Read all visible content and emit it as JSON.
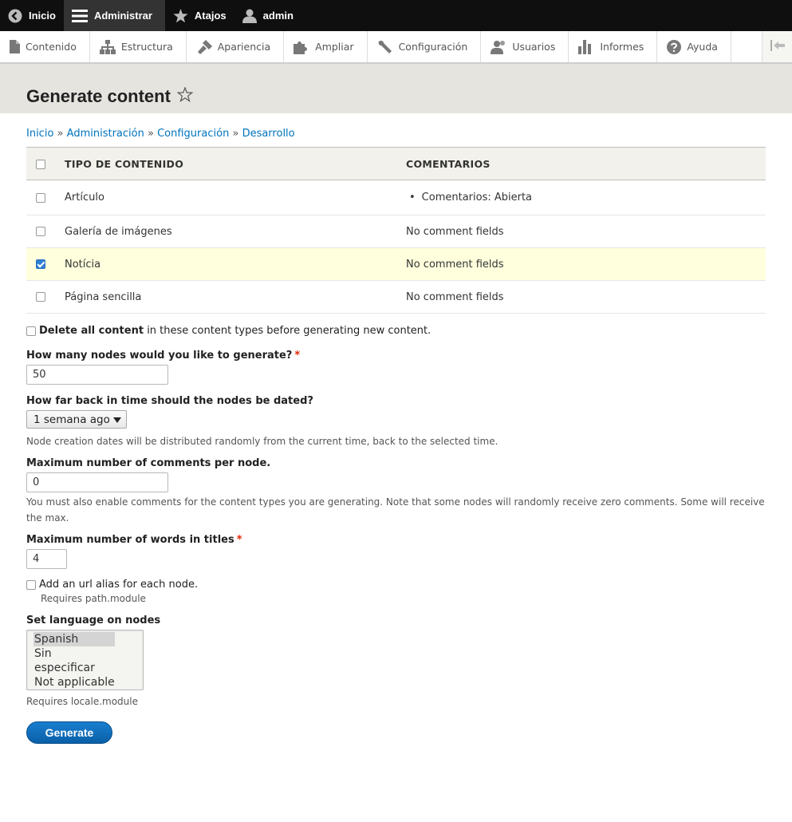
{
  "toolbar": {
    "home": "Inicio",
    "manage": "Administrar",
    "shortcuts": "Atajos",
    "user": "admin"
  },
  "tray": {
    "items": [
      {
        "label": "Contenido",
        "icon": "page-icon"
      },
      {
        "label": "Estructura",
        "icon": "sitemap-icon"
      },
      {
        "label": "Apariencia",
        "icon": "brush-icon"
      },
      {
        "label": "Ampliar",
        "icon": "puzzle-icon"
      },
      {
        "label": "Configuración",
        "icon": "wrench-icon"
      },
      {
        "label": "Usuarios",
        "icon": "people-icon"
      },
      {
        "label": "Informes",
        "icon": "bar-chart-icon"
      },
      {
        "label": "Ayuda",
        "icon": "question-icon"
      }
    ]
  },
  "page": {
    "title": "Generate content"
  },
  "breadcrumb": [
    "Inicio",
    "Administración",
    "Configuración",
    "Desarrollo"
  ],
  "breadcrumb_sep": "»",
  "table": {
    "headers": [
      "TIPO DE CONTENIDO",
      "COMENTARIOS"
    ],
    "rows": [
      {
        "type": "Artículo",
        "comments": "Comentarios: Abierta",
        "checked": false
      },
      {
        "type": "Galería de imágenes",
        "comments": "No comment fields",
        "checked": false
      },
      {
        "type": "Notícia",
        "comments": "No comment fields",
        "checked": true
      },
      {
        "type": "Página sencilla",
        "comments": "No comment fields",
        "checked": false
      }
    ]
  },
  "form": {
    "delete_bold": "Delete all content",
    "delete_rest": "in these content types before generating new content.",
    "nodes_label": "How many nodes would you like to generate?",
    "nodes_value": "50",
    "time_label": "How far back in time should the nodes be dated?",
    "time_value": "1 semana ago",
    "time_desc": "Node creation dates will be distributed randomly from the current time, back to the selected time.",
    "comments_label": "Maximum number of comments per node.",
    "comments_value": "0",
    "comments_desc": "You must also enable comments for the content types you are generating. Note that some nodes will randomly receive zero comments. Some will receive the max.",
    "words_label": "Maximum number of words in titles",
    "words_value": "4",
    "alias_label": "Add an url alias for each node.",
    "alias_desc": "Requires path.module",
    "lang_label": "Set language on nodes",
    "lang_options": [
      "Spanish",
      "Sin especificar",
      "Not applicable"
    ],
    "lang_selected": "Spanish",
    "lang_desc": "Requires locale.module",
    "required_mark": "*",
    "submit": "Generate"
  },
  "colors": {
    "link": "#0074bd",
    "toolbar_bg": "#0f0f0f",
    "header_bg": "#e5e4df",
    "selected_row": "#ffffdd",
    "button": "#0a6ec0",
    "required": "#e32700"
  }
}
